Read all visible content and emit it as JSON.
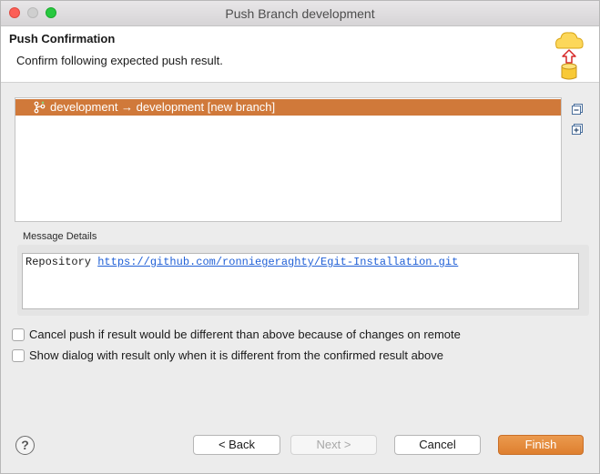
{
  "window": {
    "title": "Push Branch development"
  },
  "header": {
    "title": "Push Confirmation",
    "description": "Confirm following expected push result."
  },
  "push_list": {
    "rows": [
      {
        "label": "development → development [new branch]",
        "selected": true
      }
    ]
  },
  "message_details": {
    "label": "Message Details",
    "prefix": "Repository",
    "link": "https://github.com/ronniegeraghty/Egit-Installation.git"
  },
  "options": [
    {
      "label": "Cancel push if result would be different than above because of changes on remote",
      "checked": false
    },
    {
      "label": "Show dialog with result only when it is different from the confirmed result above",
      "checked": false
    }
  ],
  "buttons": {
    "help": "?",
    "back": "< Back",
    "next": "Next >",
    "cancel": "Cancel",
    "finish": "Finish"
  },
  "colors": {
    "selection": "#d0793a",
    "finish": "#de7f2f",
    "link": "#1f5fd6"
  },
  "icons": {
    "banner": "push-to-cloud-icon",
    "row": "branch-icon",
    "collapse": "collapse-all-icon",
    "expand": "expand-all-icon"
  }
}
